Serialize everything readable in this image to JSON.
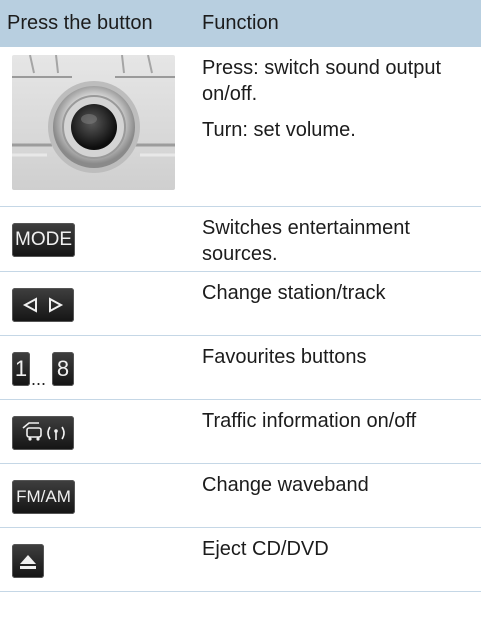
{
  "table": {
    "header": {
      "col1": "Press the button",
      "col2": "Function"
    },
    "rows": [
      {
        "icon": "volume-knob-icon",
        "lines": [
          "Press: switch sound output on/off.",
          "Turn: set volume."
        ]
      },
      {
        "icon": "mode-button-icon",
        "button_text": "MODE",
        "lines": [
          "Switches entertainment sources."
        ]
      },
      {
        "icon": "prev-next-arrows-icon",
        "lines": [
          "Change station/track"
        ]
      },
      {
        "icon": "favourite-buttons-icon",
        "key_first": "1",
        "key_sep": "...",
        "key_last": "8",
        "lines": [
          "Favourites buttons"
        ]
      },
      {
        "icon": "traffic-info-button-icon",
        "lines": [
          "Traffic information on/off"
        ]
      },
      {
        "icon": "fm-am-button-icon",
        "button_text": "FM/AM",
        "lines": [
          "Change waveband"
        ]
      },
      {
        "icon": "eject-button-icon",
        "lines": [
          "Eject CD/DVD"
        ]
      }
    ]
  },
  "colors": {
    "header_bg": "#b8cfe0",
    "divider": "#c5d7e6",
    "button_bg": "#2a2a2a"
  }
}
